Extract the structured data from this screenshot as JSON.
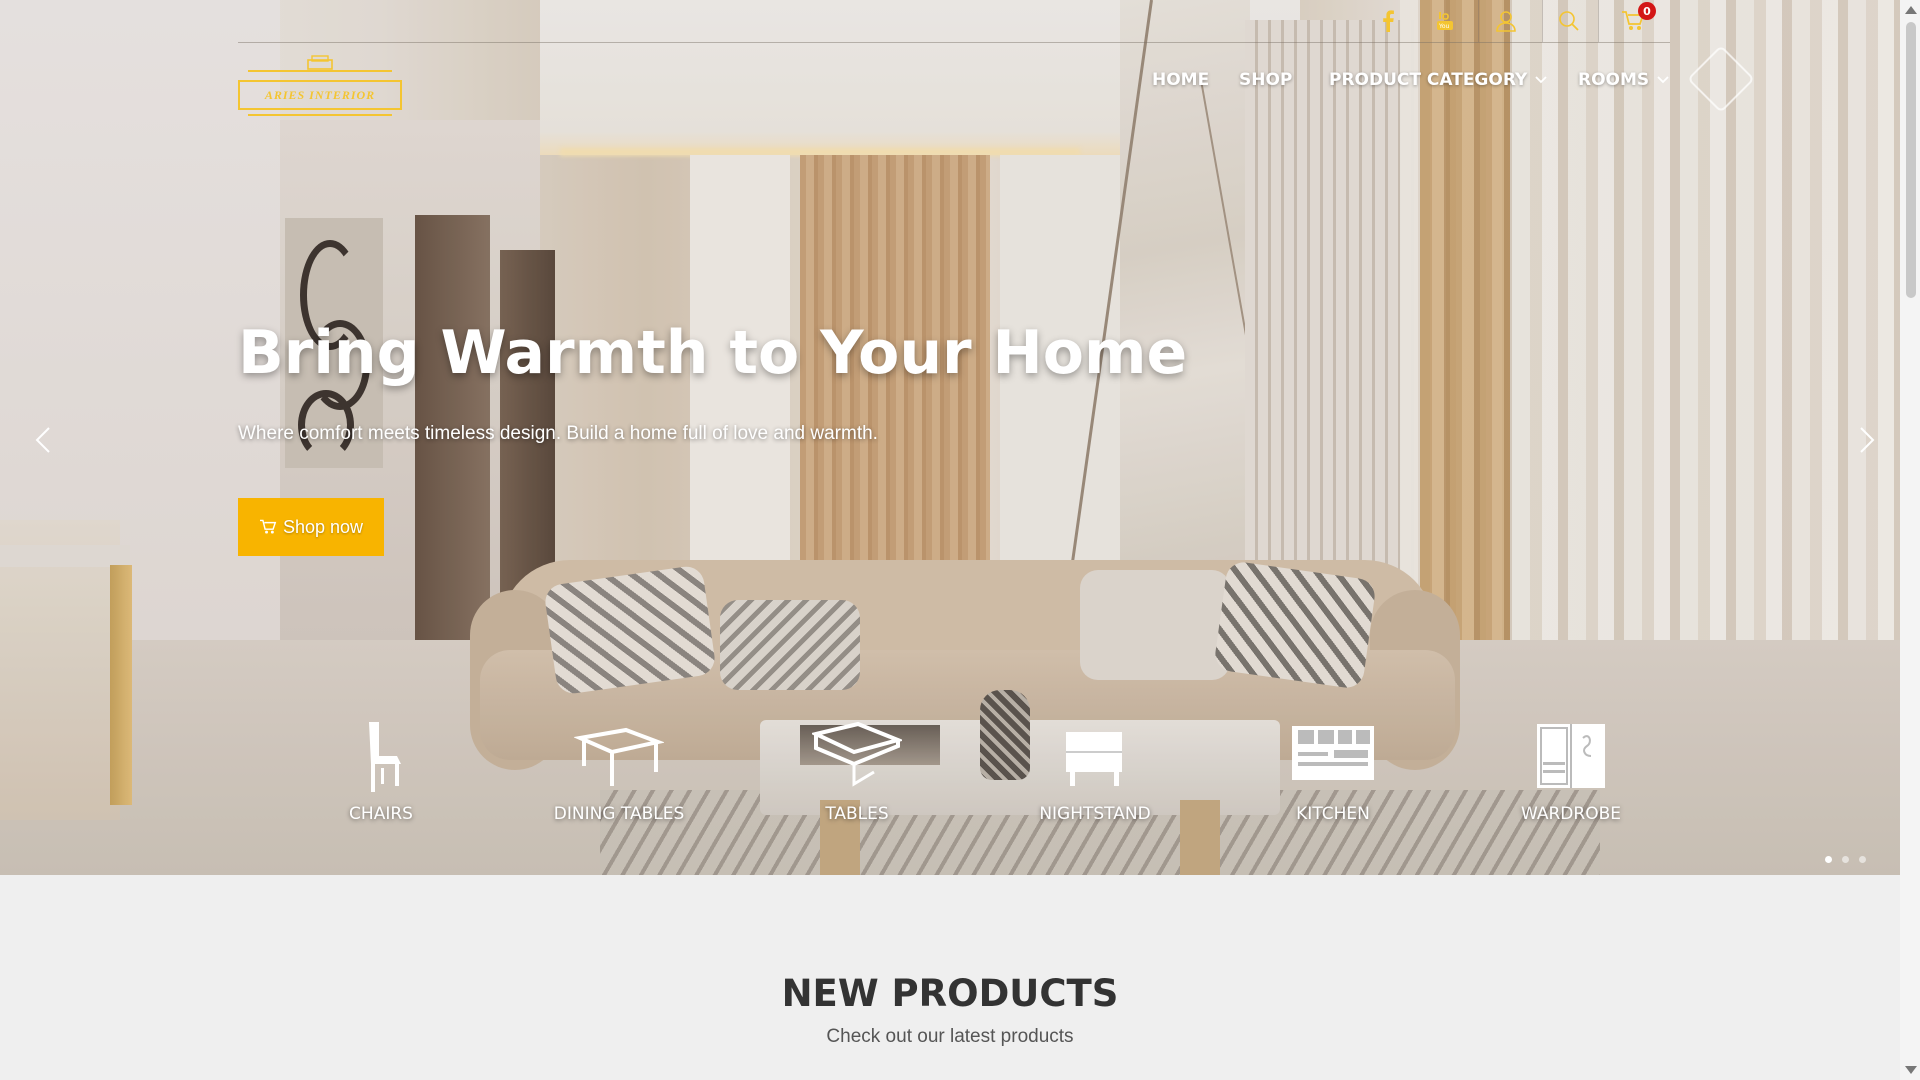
{
  "brand": {
    "logo_text": "ARIES INTERIOR",
    "accent_color": "#f4c531",
    "button_color": "#f8b400"
  },
  "topbar": {
    "icons": [
      "facebook-icon",
      "youtube-icon",
      "user-icon",
      "search-icon",
      "cart-icon"
    ],
    "cart_count": "0"
  },
  "nav": {
    "items": [
      {
        "label": "HOME"
      },
      {
        "label": "SHOP"
      },
      {
        "label": "PRODUCT CATEGORY",
        "dropdown": true
      },
      {
        "label": "ROOMS",
        "dropdown": true
      }
    ]
  },
  "hero": {
    "title": "Bring Warmth to Your Home",
    "subtitle": "Where comfort meets timeless design. Build a home full of love and warmth.",
    "cta_label": "Shop now",
    "slides_total": 3,
    "active_slide": 1
  },
  "categories": [
    {
      "label": "CHAIRS",
      "icon": "chair-icon"
    },
    {
      "label": "DINING TABLES",
      "icon": "dining-table-icon"
    },
    {
      "label": "TABLES",
      "icon": "table-icon"
    },
    {
      "label": "NIGHTSTAND",
      "icon": "nightstand-icon"
    },
    {
      "label": "KITCHEN",
      "icon": "kitchen-icon"
    },
    {
      "label": "WARDROBE",
      "icon": "wardrobe-icon"
    }
  ],
  "section": {
    "title": "NEW PRODUCTS",
    "subtitle": "Check out our latest products"
  }
}
